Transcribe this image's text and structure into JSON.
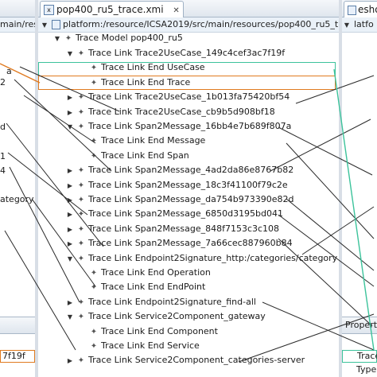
{
  "center": {
    "tab_title": "pop400_ru5_trace.xmi",
    "path": "platform:/resource/ICSA2019/src/main/resources/pop400_ru5_t",
    "root_label": "Trace Model pop400_ru5",
    "rows": [
      {
        "label": "Trace Link Trace2UseCase_149c4cef3ac7f19f",
        "indent": 2,
        "twisty": "expanded"
      },
      {
        "label": "Trace Link End UseCase",
        "indent": 3,
        "twisty": "none"
      },
      {
        "label": "Trace Link End Trace",
        "indent": 3,
        "twisty": "none"
      },
      {
        "label": "Trace Link Trace2UseCase_1b013fa75420bf54",
        "indent": 2,
        "twisty": "collapsed"
      },
      {
        "label": "Trace Link Trace2UseCase_cb9b5d908bf18",
        "indent": 2,
        "twisty": "collapsed"
      },
      {
        "label": "Trace Link Span2Message_16bb4e7b689f807a",
        "indent": 2,
        "twisty": "expanded"
      },
      {
        "label": "Trace Link End Message",
        "indent": 3,
        "twisty": "none"
      },
      {
        "label": "Trace Link End Span",
        "indent": 3,
        "twisty": "none"
      },
      {
        "label": "Trace Link Span2Message_4ad2da86e8767b82",
        "indent": 2,
        "twisty": "collapsed"
      },
      {
        "label": "Trace Link Span2Message_18c3f41100f79c2e",
        "indent": 2,
        "twisty": "collapsed"
      },
      {
        "label": "Trace Link Span2Message_da754b973390e82d",
        "indent": 2,
        "twisty": "collapsed"
      },
      {
        "label": "Trace Link Span2Message_6850d3195bd041",
        "indent": 2,
        "twisty": "collapsed"
      },
      {
        "label": "Trace Link Span2Message_848f7153c3c108",
        "indent": 2,
        "twisty": "collapsed"
      },
      {
        "label": "Trace Link Span2Message_7a66cec887960b84",
        "indent": 2,
        "twisty": "collapsed"
      },
      {
        "label": "Trace Link Endpoint2Signature_http:/categories/category",
        "indent": 2,
        "twisty": "expanded"
      },
      {
        "label": "Trace Link End Operation",
        "indent": 3,
        "twisty": "none"
      },
      {
        "label": "Trace Link End EndPoint",
        "indent": 3,
        "twisty": "none"
      },
      {
        "label": "Trace Link Endpoint2Signature_find-all",
        "indent": 2,
        "twisty": "collapsed"
      },
      {
        "label": "Trace Link Service2Component_gateway",
        "indent": 2,
        "twisty": "expanded"
      },
      {
        "label": "Trace Link End Component",
        "indent": 3,
        "twisty": "none"
      },
      {
        "label": "Trace Link End Service",
        "indent": 3,
        "twisty": "none"
      },
      {
        "label": "Trace Link Service2Component_categories-server",
        "indent": 2,
        "twisty": "collapsed"
      }
    ]
  },
  "left": {
    "path_fragment": "main/res",
    "items": [
      "a",
      "2",
      "d",
      "1",
      "4",
      "ategory"
    ],
    "bottom_value": "7f19f"
  },
  "right": {
    "tab_title": "esho",
    "path_fragment": "latfo",
    "props_title": "Propert",
    "props_rows": [
      "Trace",
      "Type"
    ]
  },
  "colors": {
    "selection_orange": "#e07a1f",
    "selection_teal": "#3cc39b",
    "trace_lines": "#2a2a2a"
  },
  "icons": {
    "tab_icon": "xmi-file-icon",
    "close_icon": "close-icon",
    "tree_node_icon": "diamond-node-icon"
  }
}
